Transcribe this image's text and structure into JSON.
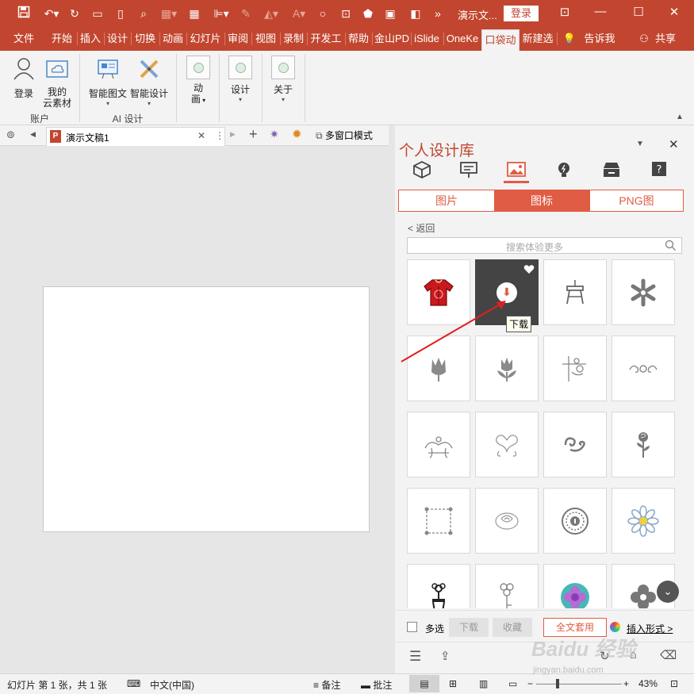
{
  "titlebar": {
    "doc_title": "演示文...",
    "login": "登录",
    "font_a": "A"
  },
  "ribbon_tabs": [
    "文件",
    "开始",
    "插入",
    "设计",
    "切换",
    "动画",
    "幻灯片",
    "审阅",
    "视图",
    "录制",
    "开发工",
    "帮助",
    "金山PD",
    "iSlide",
    "OneKe",
    "口袋动",
    "新建选",
    "告诉我",
    "共享"
  ],
  "ribbon": {
    "login": "登录",
    "cloud_line1": "我的",
    "cloud_line2": "云素材",
    "group_account": "账户",
    "smart_graphic": "智能图文",
    "smart_design": "智能设计",
    "group_ai": "AI 设计",
    "anim_line1": "动",
    "anim_line2": "画",
    "design": "设计",
    "about": "关于"
  },
  "doctabs": {
    "doc_name": "演示文稿1",
    "multi_window": "多窗口模式"
  },
  "panel": {
    "title": "个人设计库",
    "segments": [
      "图片",
      "图标",
      "PNG图"
    ],
    "active_segment": "图标",
    "back": "< 返回",
    "search_placeholder": "搜索体验更多",
    "download_tooltip": "下载",
    "multi_select": "多选",
    "download": "下载",
    "favorite": "收藏",
    "full_text": "全文套用",
    "insert_form": "插入形式 >"
  },
  "statusbar": {
    "slide_info": "幻灯片 第 1 张，共 1 张",
    "language": "中文(中国)",
    "notes": "备注",
    "comments": "批注",
    "zoom": "43%"
  },
  "watermark": {
    "brand": "Baidu 经验",
    "url": "jingyan.baidu.com"
  },
  "colors": {
    "accent": "#c2462f",
    "panel_accent": "#e05c44"
  }
}
